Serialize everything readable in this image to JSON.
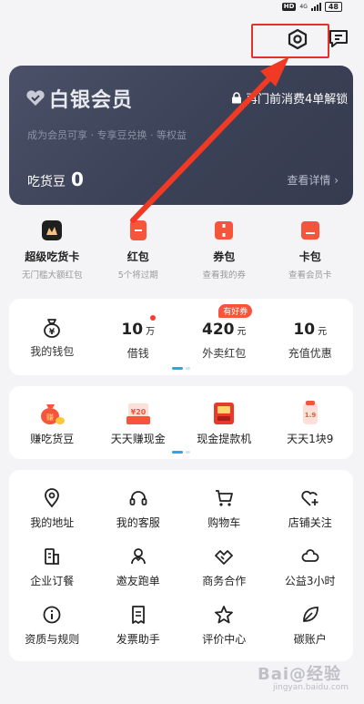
{
  "status_bar": {
    "hd": "HD",
    "network": "4G",
    "battery": "48"
  },
  "member_card": {
    "title": "白银会员",
    "lock_text": "再门前消费4单解锁",
    "subtitle": "成为会员可享 · 专享豆兑换 · 等权益",
    "bean_label": "吃货豆",
    "bean_value": "0",
    "detail_link": "查看详情 ›"
  },
  "quick_entries": [
    {
      "title": "超级吃货卡",
      "sub": "无门槛大额红包",
      "color": "#1f1f1f"
    },
    {
      "title": "红包",
      "sub": "5个将过期",
      "color": "#f5553a"
    },
    {
      "title": "券包",
      "sub": "查看我的券",
      "color": "#f5553a"
    },
    {
      "title": "卡包",
      "sub": "查看会员卡",
      "color": "#f5553a"
    }
  ],
  "wallet": {
    "items": [
      {
        "label": "我的钱包"
      },
      {
        "value": "10",
        "unit": "万",
        "label": "借钱"
      },
      {
        "value": "420",
        "unit": "元",
        "label": "外卖红包",
        "tag": "有好券"
      },
      {
        "value": "10",
        "unit": "元",
        "label": "充值优惠"
      }
    ]
  },
  "earn": {
    "items": [
      {
        "label": "赚吃货豆",
        "icon": "coin-bag-icon"
      },
      {
        "label": "天天赚现金",
        "icon": "cash-icon"
      },
      {
        "label": "现金提款机",
        "icon": "atm-icon"
      },
      {
        "label": "天天1块9",
        "icon": "lucky-bag-icon"
      }
    ]
  },
  "services": [
    {
      "label": "我的地址",
      "icon": "location-icon"
    },
    {
      "label": "我的客服",
      "icon": "headset-icon"
    },
    {
      "label": "购物车",
      "icon": "cart-icon"
    },
    {
      "label": "店铺关注",
      "icon": "heart-plus-icon"
    },
    {
      "label": "企业订餐",
      "icon": "building-icon"
    },
    {
      "label": "邀友跑单",
      "icon": "invite-icon"
    },
    {
      "label": "商务合作",
      "icon": "handshake-icon"
    },
    {
      "label": "公益3小时",
      "icon": "charity-icon"
    },
    {
      "label": "资质与规则",
      "icon": "info-icon"
    },
    {
      "label": "发票助手",
      "icon": "invoice-icon"
    },
    {
      "label": "评价中心",
      "icon": "star-icon"
    },
    {
      "label": "碳账户",
      "icon": "leaf-icon"
    }
  ],
  "watermark": {
    "text": "Bai@经验",
    "sub": "jingyan.baidu.com"
  },
  "colors": {
    "accent": "#f5553a",
    "highlight_box": "#e0332a",
    "card_bg": "#3b4156"
  }
}
